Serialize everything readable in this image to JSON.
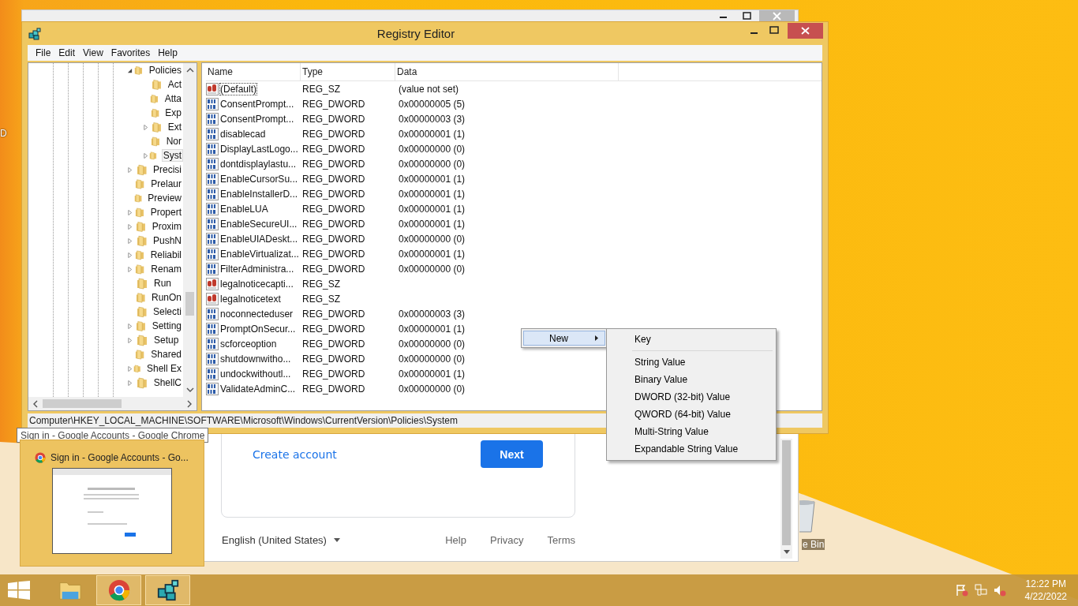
{
  "desktop": {
    "left_icon_label": "D",
    "recycle_bin_label": "e Bin"
  },
  "chrome_window": {
    "create_account": "Create account",
    "next": "Next",
    "language": "English (United States)",
    "footer_links": [
      "Help",
      "Privacy",
      "Terms"
    ]
  },
  "registry_editor": {
    "title": "Registry Editor",
    "menu": [
      "File",
      "Edit",
      "View",
      "Favorites",
      "Help"
    ],
    "tree": [
      {
        "label": "Policies",
        "expanded": true,
        "selected": false,
        "children": [
          {
            "label": "Act",
            "selected": false
          },
          {
            "label": "Atta",
            "selected": false
          },
          {
            "label": "Exp",
            "selected": false
          },
          {
            "label": "Ext",
            "expanded": false,
            "selected": false
          },
          {
            "label": "Nor",
            "selected": false
          },
          {
            "label": "Syst",
            "expanded": false,
            "selected": true
          }
        ]
      },
      {
        "label": "Precisi",
        "expanded": false,
        "selected": false
      },
      {
        "label": "Prelaur",
        "selected": false
      },
      {
        "label": "Preview",
        "selected": false
      },
      {
        "label": "Propert",
        "expanded": false,
        "selected": false
      },
      {
        "label": "Proxim",
        "expanded": false,
        "selected": false
      },
      {
        "label": "PushN",
        "expanded": false,
        "selected": false
      },
      {
        "label": "Reliabil",
        "expanded": false,
        "selected": false
      },
      {
        "label": "Renam",
        "expanded": false,
        "selected": false
      },
      {
        "label": "Run",
        "selected": false
      },
      {
        "label": "RunOn",
        "selected": false
      },
      {
        "label": "Selecti",
        "selected": false
      },
      {
        "label": "Setting",
        "expanded": false,
        "selected": false
      },
      {
        "label": "Setup",
        "expanded": false,
        "selected": false
      },
      {
        "label": "Shared",
        "selected": false
      },
      {
        "label": "Shell Ex",
        "expanded": false,
        "selected": false
      },
      {
        "label": "ShellC",
        "expanded": false,
        "selected": false
      }
    ],
    "columns": [
      "Name",
      "Type",
      "Data"
    ],
    "rows": [
      {
        "kind": "sz",
        "name": "(Default)",
        "type": "REG_SZ",
        "data": "(value not set)",
        "selected": true
      },
      {
        "kind": "dword",
        "name": "ConsentPrompt...",
        "type": "REG_DWORD",
        "data": "0x00000005 (5)",
        "selected": false
      },
      {
        "kind": "dword",
        "name": "ConsentPrompt...",
        "type": "REG_DWORD",
        "data": "0x00000003 (3)",
        "selected": false
      },
      {
        "kind": "dword",
        "name": "disablecad",
        "type": "REG_DWORD",
        "data": "0x00000001 (1)",
        "selected": false
      },
      {
        "kind": "dword",
        "name": "DisplayLastLogo...",
        "type": "REG_DWORD",
        "data": "0x00000000 (0)",
        "selected": false
      },
      {
        "kind": "dword",
        "name": "dontdisplaylastu...",
        "type": "REG_DWORD",
        "data": "0x00000000 (0)",
        "selected": false
      },
      {
        "kind": "dword",
        "name": "EnableCursorSu...",
        "type": "REG_DWORD",
        "data": "0x00000001 (1)",
        "selected": false
      },
      {
        "kind": "dword",
        "name": "EnableInstallerD...",
        "type": "REG_DWORD",
        "data": "0x00000001 (1)",
        "selected": false
      },
      {
        "kind": "dword",
        "name": "EnableLUA",
        "type": "REG_DWORD",
        "data": "0x00000001 (1)",
        "selected": false
      },
      {
        "kind": "dword",
        "name": "EnableSecureUI...",
        "type": "REG_DWORD",
        "data": "0x00000001 (1)",
        "selected": false
      },
      {
        "kind": "dword",
        "name": "EnableUIADeskt...",
        "type": "REG_DWORD",
        "data": "0x00000000 (0)",
        "selected": false
      },
      {
        "kind": "dword",
        "name": "EnableVirtualizat...",
        "type": "REG_DWORD",
        "data": "0x00000001 (1)",
        "selected": false
      },
      {
        "kind": "dword",
        "name": "FilterAdministra...",
        "type": "REG_DWORD",
        "data": "0x00000000 (0)",
        "selected": false
      },
      {
        "kind": "sz",
        "name": "legalnoticecapti...",
        "type": "REG_SZ",
        "selected": false
      },
      {
        "kind": "sz",
        "name": "legalnoticetext",
        "type": "REG_SZ",
        "selected": false
      },
      {
        "kind": "dword",
        "name": "noconnecteduser",
        "type": "REG_DWORD",
        "data": "0x00000003 (3)",
        "selected": false
      },
      {
        "kind": "dword",
        "name": "PromptOnSecur...",
        "type": "REG_DWORD",
        "data": "0x00000001 (1)",
        "selected": false
      },
      {
        "kind": "dword",
        "name": "scforceoption",
        "type": "REG_DWORD",
        "data": "0x00000000 (0)",
        "selected": false
      },
      {
        "kind": "dword",
        "name": "shutdownwitho...",
        "type": "REG_DWORD",
        "data": "0x00000000 (0)",
        "selected": false
      },
      {
        "kind": "dword",
        "name": "undockwithoutl...",
        "type": "REG_DWORD",
        "data": "0x00000001 (1)",
        "selected": false
      },
      {
        "kind": "dword",
        "name": "ValidateAdminC...",
        "type": "REG_DWORD",
        "data": "0x00000000 (0)",
        "selected": false
      }
    ],
    "status_bar": "Computer\\HKEY_LOCAL_MACHINE\\SOFTWARE\\Microsoft\\Windows\\CurrentVersion\\Policies\\System"
  },
  "context_menu": {
    "items": [
      {
        "label": "New",
        "selected": true
      }
    ]
  },
  "submenu": {
    "items": [
      {
        "kind": "item",
        "label": "Key"
      },
      {
        "kind": "separator"
      },
      {
        "kind": "item",
        "label": "String Value"
      },
      {
        "kind": "item",
        "label": "Binary Value"
      },
      {
        "kind": "item",
        "label": "DWORD (32-bit) Value"
      },
      {
        "kind": "item",
        "label": "QWORD (64-bit) Value"
      },
      {
        "kind": "item",
        "label": "Multi-String Value"
      },
      {
        "kind": "item",
        "label": "Expandable String Value"
      }
    ]
  },
  "taskbar_preview": {
    "tooltip": "Sign in - Google Accounts - Google Chrome",
    "title": "Sign in - Google Accounts - Go..."
  },
  "taskbar": {
    "apps": [
      {
        "kind": "explorer",
        "highlighted": false
      },
      {
        "kind": "chrome",
        "highlighted": true
      },
      {
        "kind": "regedit",
        "highlighted": true
      }
    ],
    "clock": {
      "time": "12:22 PM",
      "date": "4/22/2022"
    }
  }
}
